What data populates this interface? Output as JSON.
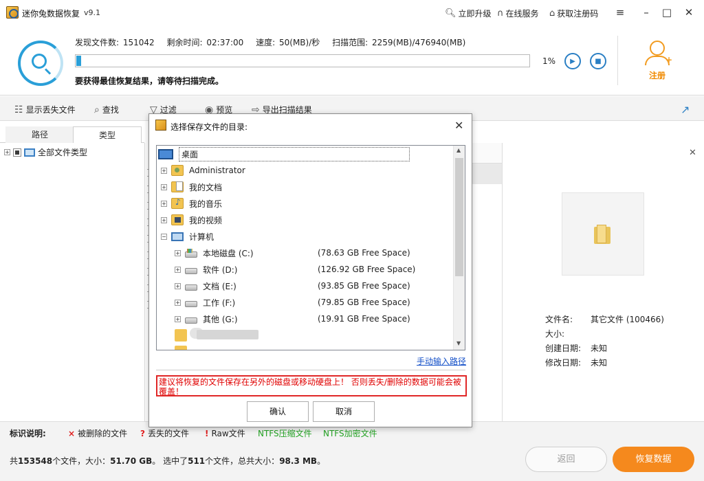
{
  "window": {
    "title": "迷你兔数据恢复",
    "version": "v9.1",
    "links": {
      "upgrade": "立即升级",
      "online_service": "在线服务",
      "get_code": "获取注册码"
    }
  },
  "scan": {
    "found_label": "发现文件数:",
    "found_value": "151042",
    "remaining_label": "剩余时间:",
    "remaining_value": "02:37:00",
    "speed_label": "速度:",
    "speed_value": "50(MB)/秒",
    "range_label": "扫描范围:",
    "range_value": "2259(MB)/476940(MB)",
    "progress_percent": 1,
    "progress_text": "1%",
    "hint": "要获得最佳恢复结果，请等待扫描完成。",
    "register_label": "注册"
  },
  "toolbar": {
    "show_lost": "显示丢失文件",
    "find": "查找",
    "filter": "过滤",
    "preview": "预览",
    "export": "导出扫描结果"
  },
  "left": {
    "tab_path": "路径",
    "tab_type": "类型",
    "root_label": "全部文件类型"
  },
  "preview": {
    "filename_label": "文件名:",
    "filename_value": "其它文件 (100466)",
    "size_label": "大小:",
    "size_value": "",
    "created_label": "创建日期:",
    "created_value": "未知",
    "modified_label": "修改日期:",
    "modified_value": "未知"
  },
  "legend": {
    "title": "标识说明:",
    "deleted": "被删除的文件",
    "lost": "丢失的文件",
    "raw": "Raw文件",
    "ntfs_compressed": "NTFS压缩文件",
    "ntfs_encrypted": "NTFS加密文件",
    "colors": {
      "deleted": "#e02020",
      "lost": "#e02020",
      "raw": "#e02020",
      "ntfs": "#23a323"
    }
  },
  "status": {
    "prefix": "共",
    "total_files": "153548",
    "mid1": "个文件，大小：",
    "total_size": "51.70 GB",
    "mid2": "。 选中了",
    "selected_files": "511",
    "mid3": "个文件，总共大小：",
    "selected_size": "98.3 MB",
    "suffix": "。",
    "back_button": "返回",
    "recover_button": "恢复数据"
  },
  "dialog": {
    "title": "选择保存文件的目录:",
    "tree": {
      "desktop": "桌面",
      "administrator": "Administrator",
      "my_docs": "我的文档",
      "my_music": "我的音乐",
      "my_videos": "我的视频",
      "computer": "计算机",
      "drives": [
        {
          "label": "本地磁盘 (C:)",
          "space": "(78.63 GB Free Space)"
        },
        {
          "label": "软件 (D:)",
          "space": "(126.92 GB Free Space)"
        },
        {
          "label": "文档 (E:)",
          "space": "(93.85 GB Free Space)"
        },
        {
          "label": "工作 (F:)",
          "space": "(79.85 GB Free Space)"
        },
        {
          "label": "其他 (G:)",
          "space": "(19.91 GB Free Space)"
        }
      ]
    },
    "manual_path": "手动输入路径",
    "warning": "建议将恢复的文件保存在另外的磁盘或移动硬盘上！ 否则丢失/删除的数据可能会被覆盖！",
    "ok": "确认",
    "cancel": "取消"
  }
}
